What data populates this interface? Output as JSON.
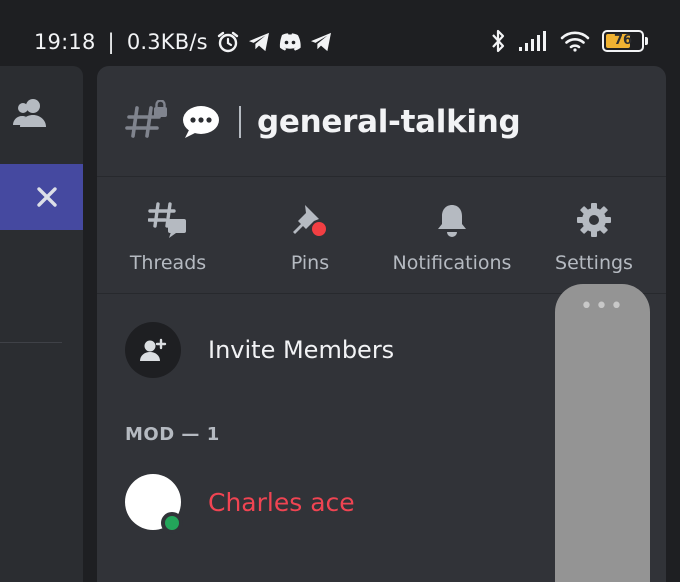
{
  "status_bar": {
    "time": "19:18",
    "separator": "|",
    "speed": "0.3KB/s",
    "battery": "76",
    "icons": [
      "alarm-icon",
      "telegram-icon",
      "discord-icon",
      "telegram-icon",
      "bluetooth-icon",
      "signal-icon",
      "wifi-icon",
      "battery-icon"
    ]
  },
  "left_panel": {
    "icons": [
      "members-icon",
      "close-icon"
    ],
    "accent_color": "#4549a0"
  },
  "header": {
    "emoji": "💬",
    "channel_name": "general-talking"
  },
  "actions": [
    {
      "label": "Threads",
      "icon": "threads-icon"
    },
    {
      "label": "Pins",
      "icon": "pin-icon"
    },
    {
      "label": "Notifications",
      "icon": "bell-icon"
    },
    {
      "label": "Settings",
      "icon": "gear-icon"
    }
  ],
  "invite": {
    "label": "Invite Members",
    "icon": "add-member-icon"
  },
  "sections": [
    {
      "title": "MOD — 1",
      "members": [
        {
          "name": "Charles ace",
          "name_color": "#f04452",
          "status": "online",
          "status_color": "#23a55a"
        }
      ]
    }
  ],
  "overlay": {
    "handle": "•••"
  }
}
